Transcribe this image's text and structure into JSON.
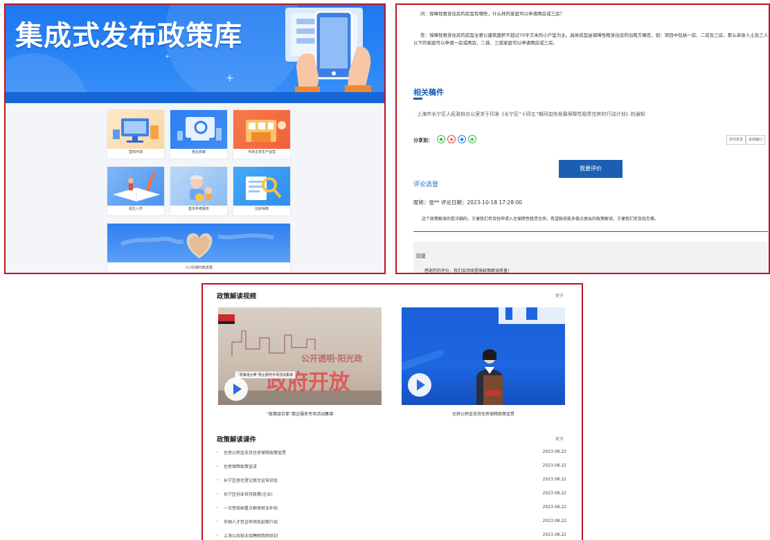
{
  "panel1": {
    "hero_title": "集成式发布政策库",
    "tiles": [
      {
        "label": "营商环境"
      },
      {
        "label": "惠企政策"
      },
      {
        "label": "市场主体生产运营"
      },
      {
        "label": "招生入学"
      },
      {
        "label": "基本养老服务"
      },
      {
        "label": "住房保障"
      }
    ],
    "wide_tile": {
      "label": "人口长期均衡发展"
    }
  },
  "panel2": {
    "question": "问：保障性租赁住房的房型有哪些，什么样的家庭可以申请两房或三房？",
    "answer_line1": "答：保障性租赁住房的房型主要以建筑面积不超过70平方米的小户型为主。具体房型由保障性租赁住房的出租方确定，如：项目中包括一房、二房及三房，那么单身人士及三人",
    "answer_line2": "以下的家庭可以申请一房或两房，二孩、三孩家庭可以申请两房或三房。",
    "related_title": "相关稿件",
    "related_item": "上海市长宁区人民政府办公室关于印发《长宁区“十四五”期间加快发展保障性租赁住房的行动计划》的通知",
    "share_label": "分享到：",
    "print_label": "打印本页",
    "close_label": "关闭窗口",
    "rate_button": "我要评价",
    "comment_title": "评论选登",
    "comment_meta": "昵称：张**      评论日期：2023-10-18 17:28:00",
    "comment_body": "这个政策解读的挺详细的，方便我们老百姓申请入住保障性租赁住房。希望政府能多做点类似的政策解读，方便我们老百姓办事。",
    "reply_title": "回复",
    "reply_text": "感谢您的评价，我们会持续提高政策解读质量！"
  },
  "panel3": {
    "video_section_title": "政策解读视频",
    "video_more": "更多",
    "videos": [
      {
        "caption": "“政策组合拳”惠企服务专场活动集锦",
        "overlay_text": "“政策组合拳”惠企服务专场活动集锦",
        "banner_text": "政府开放"
      },
      {
        "caption": "住房公积金支持住房保障政策宣贯"
      }
    ],
    "course_section_title": "政策解读课件",
    "course_more": "更多",
    "courses": [
      {
        "title": "住房公积金支持住房保障政策宣贯",
        "date": "2023.08.22"
      },
      {
        "title": "住房保障政策宣讲",
        "date": "2023.08.22"
      },
      {
        "title": "长宁区居住登记居住证培训会",
        "date": "2023.08.22"
      },
      {
        "title": "长宁区创业扶持政策(企业)",
        "date": "2023.08.22"
      },
      {
        "title": "一次性吸纳重点群体就业补贴",
        "date": "2023.08.22"
      },
      {
        "title": "外国人才签证申领及延期介绍",
        "date": "2023.08.22"
      },
      {
        "title": "上海公共就业招聘网用网培训",
        "date": "2023.08.22"
      }
    ]
  },
  "colors": {
    "frame_red": "#c1121f",
    "brand_blue": "#1b5fb2",
    "hero_blue": "#2b86f6"
  }
}
